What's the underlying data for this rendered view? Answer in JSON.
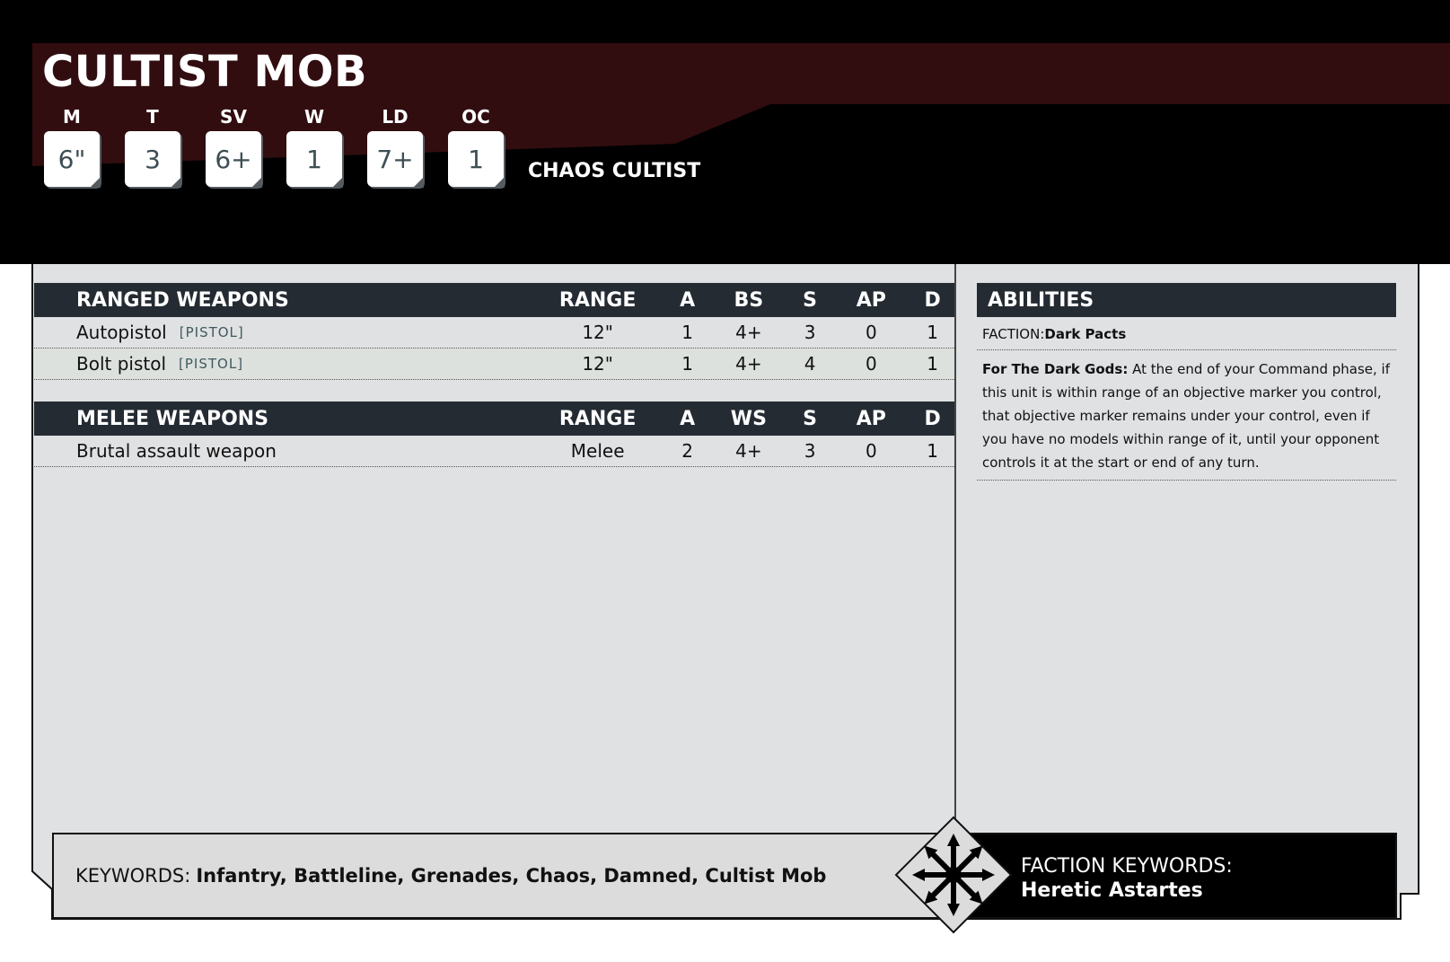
{
  "unit": {
    "name": "CULTIST MOB",
    "model": "CHAOS CULTIST"
  },
  "stats": [
    {
      "label": "M",
      "value": "6\""
    },
    {
      "label": "T",
      "value": "3"
    },
    {
      "label": "SV",
      "value": "6+"
    },
    {
      "label": "W",
      "value": "1"
    },
    {
      "label": "LD",
      "value": "7+"
    },
    {
      "label": "OC",
      "value": "1"
    }
  ],
  "ranged": {
    "title": "RANGED WEAPONS",
    "cols": [
      "RANGE",
      "A",
      "BS",
      "S",
      "AP",
      "D"
    ],
    "rows": [
      {
        "name": "Autopistol",
        "kw": "[PISTOL]",
        "range": "12\"",
        "a": "1",
        "skill": "4+",
        "s": "3",
        "ap": "0",
        "d": "1"
      },
      {
        "name": "Bolt pistol",
        "kw": "[PISTOL]",
        "range": "12\"",
        "a": "1",
        "skill": "4+",
        "s": "4",
        "ap": "0",
        "d": "1"
      }
    ]
  },
  "melee": {
    "title": "MELEE WEAPONS",
    "cols": [
      "RANGE",
      "A",
      "WS",
      "S",
      "AP",
      "D"
    ],
    "rows": [
      {
        "name": "Brutal assault weapon",
        "kw": "",
        "range": "Melee",
        "a": "2",
        "skill": "4+",
        "s": "3",
        "ap": "0",
        "d": "1"
      }
    ]
  },
  "abilities": {
    "title": "ABILITIES",
    "faction_label": "FACTION:",
    "faction_value": "Dark Pacts",
    "ability_name": "For The Dark Gods:",
    "ability_text": "At the end of your Command phase, if this unit is within range of an objective marker you control, that objective marker remains under your control, even if you have no models within range of it, until your opponent controls it at the start or end of any turn."
  },
  "keywords": {
    "label": "KEYWORDS:",
    "values": "Infantry, Battleline, Grenades, Chaos, Damned, Cultist Mob"
  },
  "faction_keywords": {
    "label": "FACTION KEYWORDS:",
    "value": "Heretic Astartes",
    "icon": "chaos-star-icon"
  },
  "colors": {
    "header_bg": "#000000",
    "header_band": "#310d10",
    "table_head": "#242b33",
    "card_bg": "#e0e1e3"
  }
}
